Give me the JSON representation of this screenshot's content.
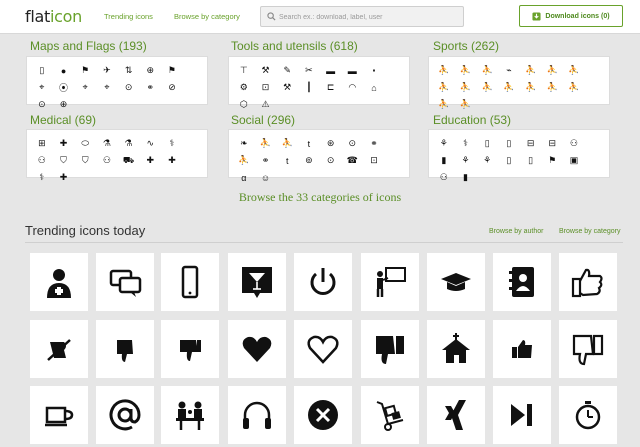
{
  "header": {
    "logo_a": "flat",
    "logo_b": "icon",
    "nav": [
      "Trending icons",
      "Browse by category"
    ],
    "search_placeholder": "Search ex.: download, label, user",
    "download_label": "Download icons (0)"
  },
  "categories": [
    {
      "title": "Maps and Flags (193)",
      "icons": [
        "▯",
        "●",
        "⚑",
        "✈",
        "⇅",
        "⊕",
        "⚑",
        "⌖",
        "⦿",
        "⌖",
        "⌖",
        "⊙",
        "⚭",
        "⊘",
        "⊙",
        "⊕"
      ]
    },
    {
      "title": "Tools and utensils (618)",
      "icons": [
        "⊤",
        "⚒",
        "✎",
        "✂",
        "▬",
        "▬",
        "⬝",
        "⚙",
        "⊡",
        "⚒",
        "┃",
        "⊏",
        "◠",
        "⌂",
        "⬡",
        "⚠"
      ]
    },
    {
      "title": "Sports (262)",
      "icons": [
        "⛹",
        "⛹",
        "⛹",
        "⌁",
        "⛹",
        "⛹",
        "⛹",
        "⛹",
        "⛹",
        "⛹",
        "⛹",
        "⛹",
        "⛹",
        "⛹",
        "⛹",
        "⛹"
      ]
    },
    {
      "title": "Medical (69)",
      "icons": [
        "⊞",
        "✚",
        "⬭",
        "⚗",
        "⚗",
        "∿",
        "⚕",
        "⚇",
        "⛉",
        "⛉",
        "⚇",
        "⛟",
        "✚",
        "✚",
        "⚕",
        "✚"
      ]
    },
    {
      "title": "Social (296)",
      "icons": [
        "❧",
        "⛹",
        "⛹",
        "t",
        "⊛",
        "⊙",
        "⚭",
        "⛹",
        "⚭",
        "t",
        "⊚",
        "⊙",
        "☎",
        "⊡",
        "α",
        "☺"
      ]
    },
    {
      "title": "Education (53)",
      "icons": [
        "⚘",
        "⚕",
        "▯",
        "▯",
        "⊟",
        "⊟",
        "⚇",
        "▮",
        "⚘",
        "⚘",
        "▯",
        "▯",
        "⚑",
        "▣",
        "⚇",
        "▮"
      ]
    }
  ],
  "browse_all": "Browse the 33 categories of icons",
  "trending": {
    "title": "Trending icons today",
    "browse_author": "Browse by author",
    "browse_category": "Browse by category",
    "tiles": [
      "doctor-icon",
      "chat-bubbles-icon",
      "smartphone-icon",
      "cocktail-icon",
      "power-icon",
      "teacher-board-icon",
      "graduation-cap-icon",
      "contact-book-icon",
      "thumbs-up-icon",
      "thumbs-down-fist-icon",
      "thumbs-down-small-icon",
      "thumbs-down-icon",
      "heart-icon",
      "heart-outline-icon",
      "thumbs-down-filled-icon",
      "house-cross-icon",
      "thumbs-up-small-icon",
      "thumbs-down-outline-icon",
      "coffee-cup-icon",
      "at-sign-icon",
      "meeting-icon",
      "headphones-icon",
      "close-circle-icon",
      "hand-truck-icon",
      "xing-icon",
      "skip-forward-icon",
      "stopwatch-icon"
    ]
  }
}
